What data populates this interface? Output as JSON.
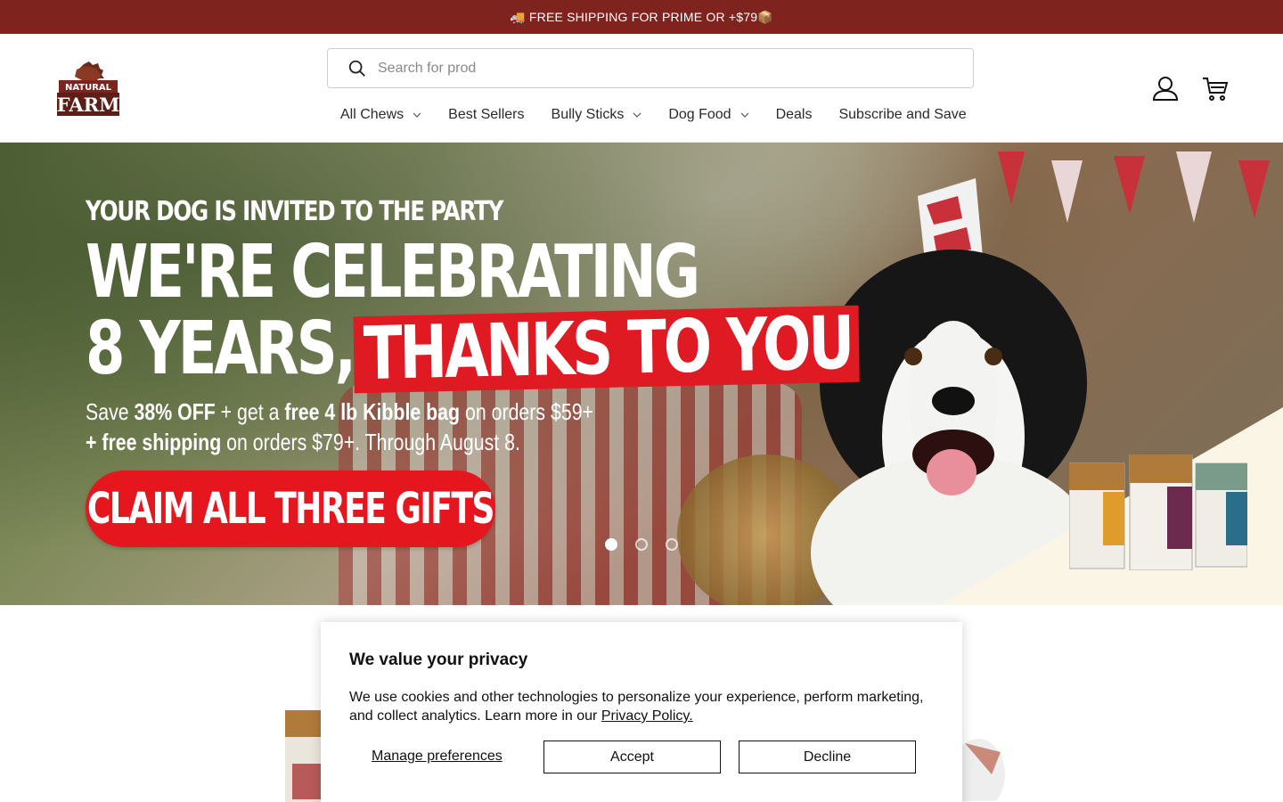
{
  "announcement": {
    "text": "🚚 FREE SHIPPING FOR PRIME OR +$79📦"
  },
  "brand": {
    "name": "NATURAL FARM",
    "primary_color": "#7f231e",
    "cta_color": "#e5161e"
  },
  "search": {
    "placeholder": "Search for prod"
  },
  "nav": [
    {
      "label": "All Chews",
      "has_dropdown": true
    },
    {
      "label": "Best Sellers",
      "has_dropdown": false
    },
    {
      "label": "Bully Sticks",
      "has_dropdown": true
    },
    {
      "label": "Dog Food",
      "has_dropdown": true
    },
    {
      "label": "Deals",
      "has_dropdown": false
    },
    {
      "label": "Subscribe and Save",
      "has_dropdown": false
    }
  ],
  "header_icons": [
    "account-icon",
    "cart-icon"
  ],
  "hero": {
    "kicker": "YOUR DOG IS INVITED TO THE PARTY",
    "headline_line1": "WE'RE CELEBRATING",
    "headline_line2_a": "8 YEARS,",
    "headline_line2_b": "THANKS TO YOU",
    "offer": {
      "l1_a": "Save ",
      "l1_b": "38% OFF",
      "l1_c": " + get a ",
      "l1_d": "free 4 lb Kibble bag",
      "l1_e": " on orders $59+",
      "l2_a": "+ free shipping",
      "l2_b": " on orders $79+. Through August 8."
    },
    "cta": "CLAIM ALL THREE GIFTS",
    "slides": 3,
    "active_slide": 1
  },
  "cookie": {
    "title": "We value your privacy",
    "body": "We use cookies and other technologies to personalize your experience, perform marketing, and collect analytics. Learn more in our ",
    "policy_link": "Privacy Policy.",
    "manage": "Manage preferences",
    "accept": "Accept",
    "decline": "Decline"
  }
}
